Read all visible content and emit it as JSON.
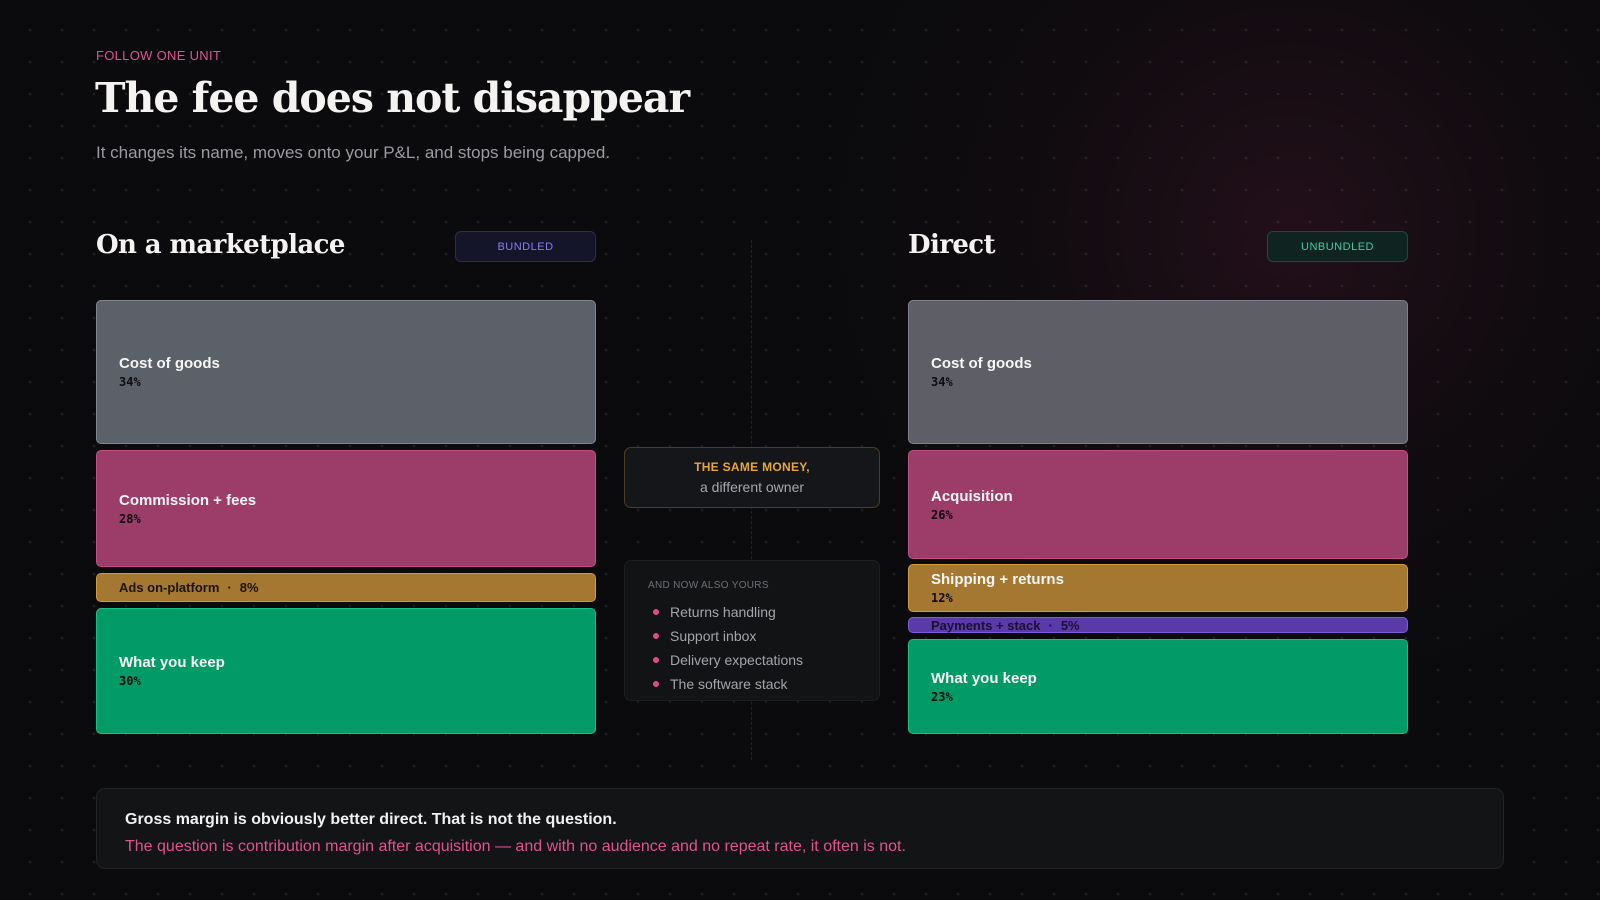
{
  "header": {
    "eyebrow": "FOLLOW ONE UNIT",
    "title": "The fee does not disappear",
    "subtitle": "It changes its name, moves onto your P&L, and stops being capped."
  },
  "left": {
    "title": "On a marketplace",
    "badge": "BUNDLED",
    "segments": [
      {
        "name": "Cost of goods",
        "pct": "34%",
        "value": 34,
        "color": "#5c6068"
      },
      {
        "name": "Commission + fees",
        "pct": "28%",
        "value": 28,
        "color": "#9c3c68"
      },
      {
        "name": "Ads on-platform",
        "pct": "8%",
        "value": 8,
        "color": "#a47830"
      },
      {
        "name": "What you keep",
        "pct": "30%",
        "value": 30,
        "color": "#029a66"
      }
    ]
  },
  "right": {
    "title": "Direct",
    "badge": "UNBUNDLED",
    "segments": [
      {
        "name": "Cost of goods",
        "pct": "34%",
        "value": 34,
        "color": "#5e5e66"
      },
      {
        "name": "Acquisition",
        "pct": "26%",
        "value": 26,
        "color": "#9c3c68"
      },
      {
        "name": "Shipping + returns",
        "pct": "12%",
        "value": 12,
        "color": "#a47830"
      },
      {
        "name": "Payments + stack",
        "pct": "5%",
        "value": 5,
        "color": "#5a3aa8"
      },
      {
        "name": "What you keep",
        "pct": "23%",
        "value": 23,
        "color": "#029a66"
      }
    ]
  },
  "middle": {
    "same_money_line1": "THE SAME MONEY,",
    "same_money_line2": "a different owner",
    "also_header": "AND NOW ALSO YOURS",
    "also_items": [
      "Returns handling",
      "Support inbox",
      "Delivery expectations",
      "The software stack"
    ]
  },
  "callout": {
    "line1": "Gross margin is obviously better direct. That is not the question.",
    "line2": "The question is contribution margin after acquisition — and with no audience and no repeat rate, it often is not."
  },
  "colors": {
    "accent_pink": "#e0528e",
    "accent_amber": "#e7a63c",
    "accent_green": "#3ccf97",
    "accent_violet": "#8b7df0"
  }
}
